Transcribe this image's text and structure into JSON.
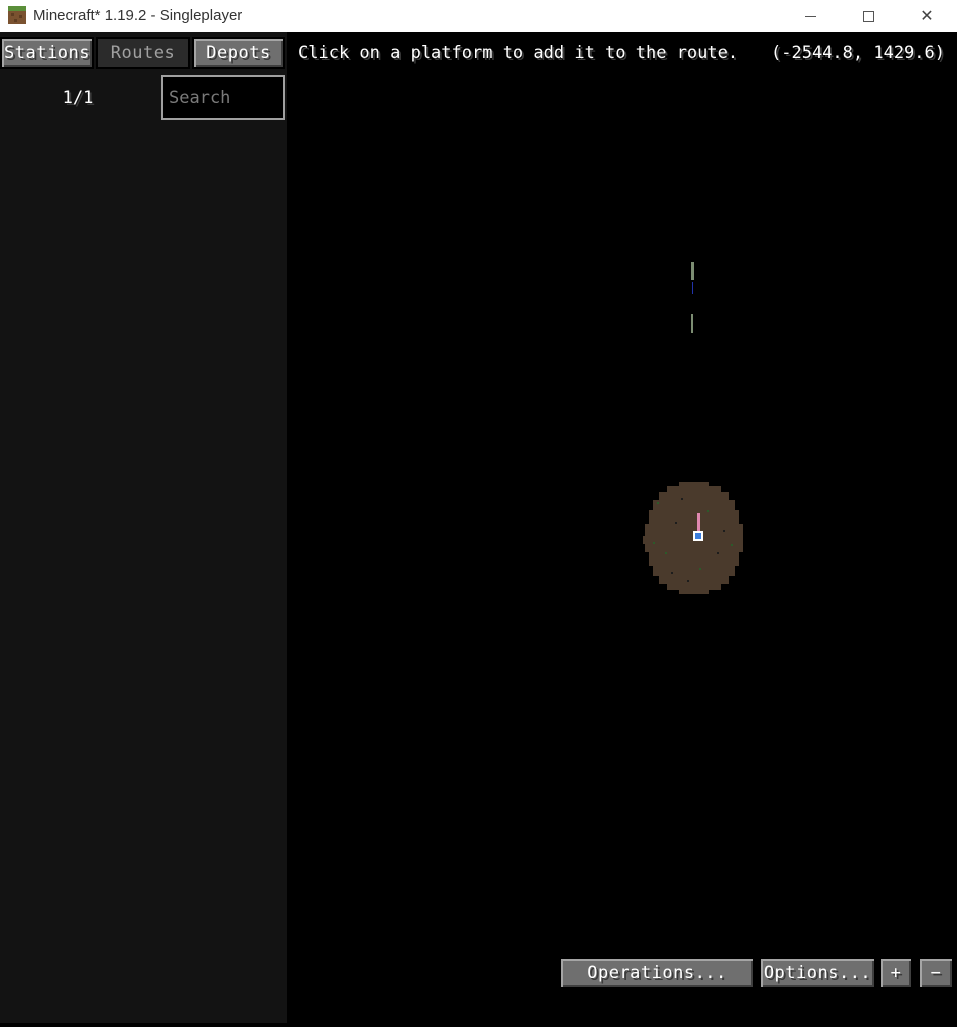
{
  "window": {
    "title": "Minecraft* 1.19.2 - Singleplayer",
    "controls": {
      "minimize": "—",
      "maximize": "☐",
      "close": "✕"
    }
  },
  "tabs": [
    {
      "label": "Stations",
      "state": "enabled"
    },
    {
      "label": "Routes",
      "state": "selected"
    },
    {
      "label": "Depots",
      "state": "enabled"
    }
  ],
  "sidebar": {
    "page_counter": "1/1",
    "search_placeholder": "Search"
  },
  "header": {
    "instruction": "Click on a platform to add it to the route.",
    "coordinates": "(-2544.8, 1429.6)"
  },
  "map": {
    "background": "#000000",
    "depot_color": "#4a3a2c",
    "platform_color": "#e088b0",
    "marker_color": "#3b7ddd"
  },
  "footer": {
    "operations_label": "Operations...",
    "options_label": "Options...",
    "zoom_in_label": "+",
    "zoom_out_label": "−"
  }
}
